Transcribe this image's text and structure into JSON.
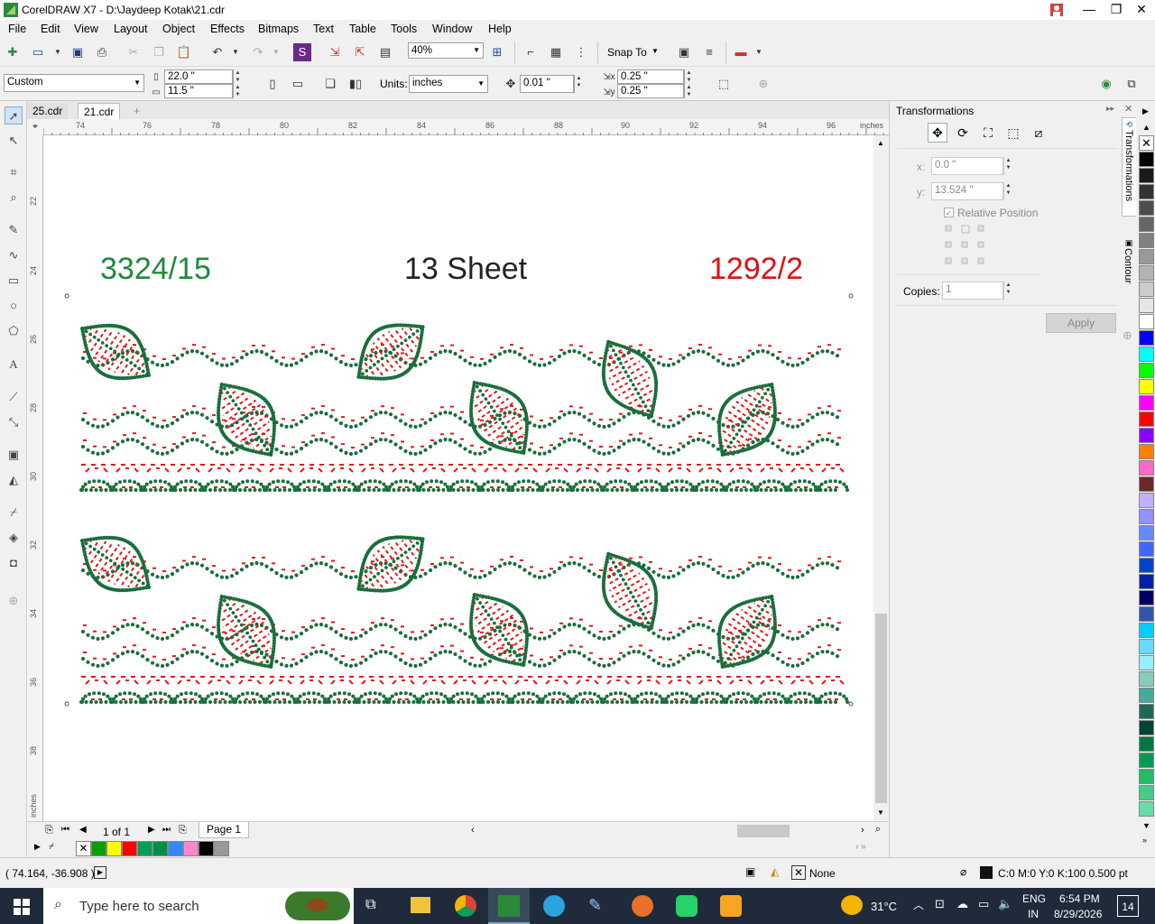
{
  "window": {
    "title": "CorelDRAW X7 - D:\\Jaydeep Kotak\\21.cdr"
  },
  "menu": [
    "File",
    "Edit",
    "View",
    "Layout",
    "Object",
    "Effects",
    "Bitmaps",
    "Text",
    "Table",
    "Tools",
    "Window",
    "Help"
  ],
  "toolbar": {
    "zoom": "40%",
    "snap_to": "Snap To"
  },
  "propbar": {
    "page_size": "Custom",
    "width": "22.0 \"",
    "height": "11.5 \"",
    "units_label": "Units:",
    "units": "inches",
    "nudge": "0.01 \"",
    "dup_x": "0.25 \"",
    "dup_y": "0.25 \""
  },
  "tabs": [
    "25.cdr",
    "21.cdr"
  ],
  "ruler": {
    "h_ticks": [
      "74",
      "76",
      "78",
      "80",
      "82",
      "84",
      "86",
      "88",
      "90",
      "92",
      "94",
      "96"
    ],
    "h_unit": "inches",
    "v_ticks": [
      "22",
      "24",
      "26",
      "28",
      "30",
      "32",
      "34",
      "36",
      "38"
    ],
    "v_unit": "inches"
  },
  "canvas": {
    "label_left": "3324/15",
    "label_center": "13 Sheet",
    "label_right": "1292/2",
    "color_left": "#1e8a3c",
    "color_center": "#222222",
    "color_right": "#e01010",
    "dot_green": "#1a6e3c",
    "dash_red": "#e01a1a"
  },
  "pagebar": {
    "counter": "1 of 1",
    "page_tab": "Page 1"
  },
  "docker": {
    "title": "Transformations",
    "x_label": "x:",
    "x_value": "0.0 \"",
    "y_label": "y:",
    "y_value": "13.524 \"",
    "relative_position": "Relative Position",
    "copies_label": "Copies:",
    "copies_value": "1",
    "apply": "Apply",
    "side_tab_1": "Transformations",
    "side_tab_2": "Contour"
  },
  "palette_colors": [
    "#000000",
    "#1a1a1a",
    "#333333",
    "#4d4d4d",
    "#666666",
    "#808080",
    "#999999",
    "#b3b3b3",
    "#cccccc",
    "#e6e6e6",
    "#ffffff",
    "#0000ff",
    "#00ffff",
    "#00ff00",
    "#ffff00",
    "#ff00ff",
    "#ff0000",
    "#8b00ff",
    "#ff8000",
    "#ff66cc",
    "#6b2a2a",
    "#c0b0ff",
    "#9090ff",
    "#6688ff",
    "#4466ff",
    "#0044cc",
    "#0022aa",
    "#000066",
    "#3355aa",
    "#00ccff",
    "#66ddff",
    "#99eeff",
    "#88ccbb",
    "#44aa99",
    "#226655",
    "#004433",
    "#007744",
    "#009955",
    "#22bb66",
    "#44cc88",
    "#66ddaa"
  ],
  "doc_palette_colors": [
    "#ffffff",
    "#00a000",
    "#ffff00",
    "#ff0000",
    "#00a050",
    "#00904a",
    "#3388ff",
    "#ff88cc",
    "#000000",
    "#999999"
  ],
  "status": {
    "coords": "( 74.164, -36.908 )",
    "fill_label": "None",
    "outline": "C:0 M:0 Y:0 K:100  0.500 pt"
  },
  "taskbar": {
    "search": "Type here to search",
    "weather": "31°C",
    "lang1": "ENG",
    "lang2": "IN",
    "time": "6:54 PM",
    "date": "8/29/2026",
    "notifications": "14"
  }
}
